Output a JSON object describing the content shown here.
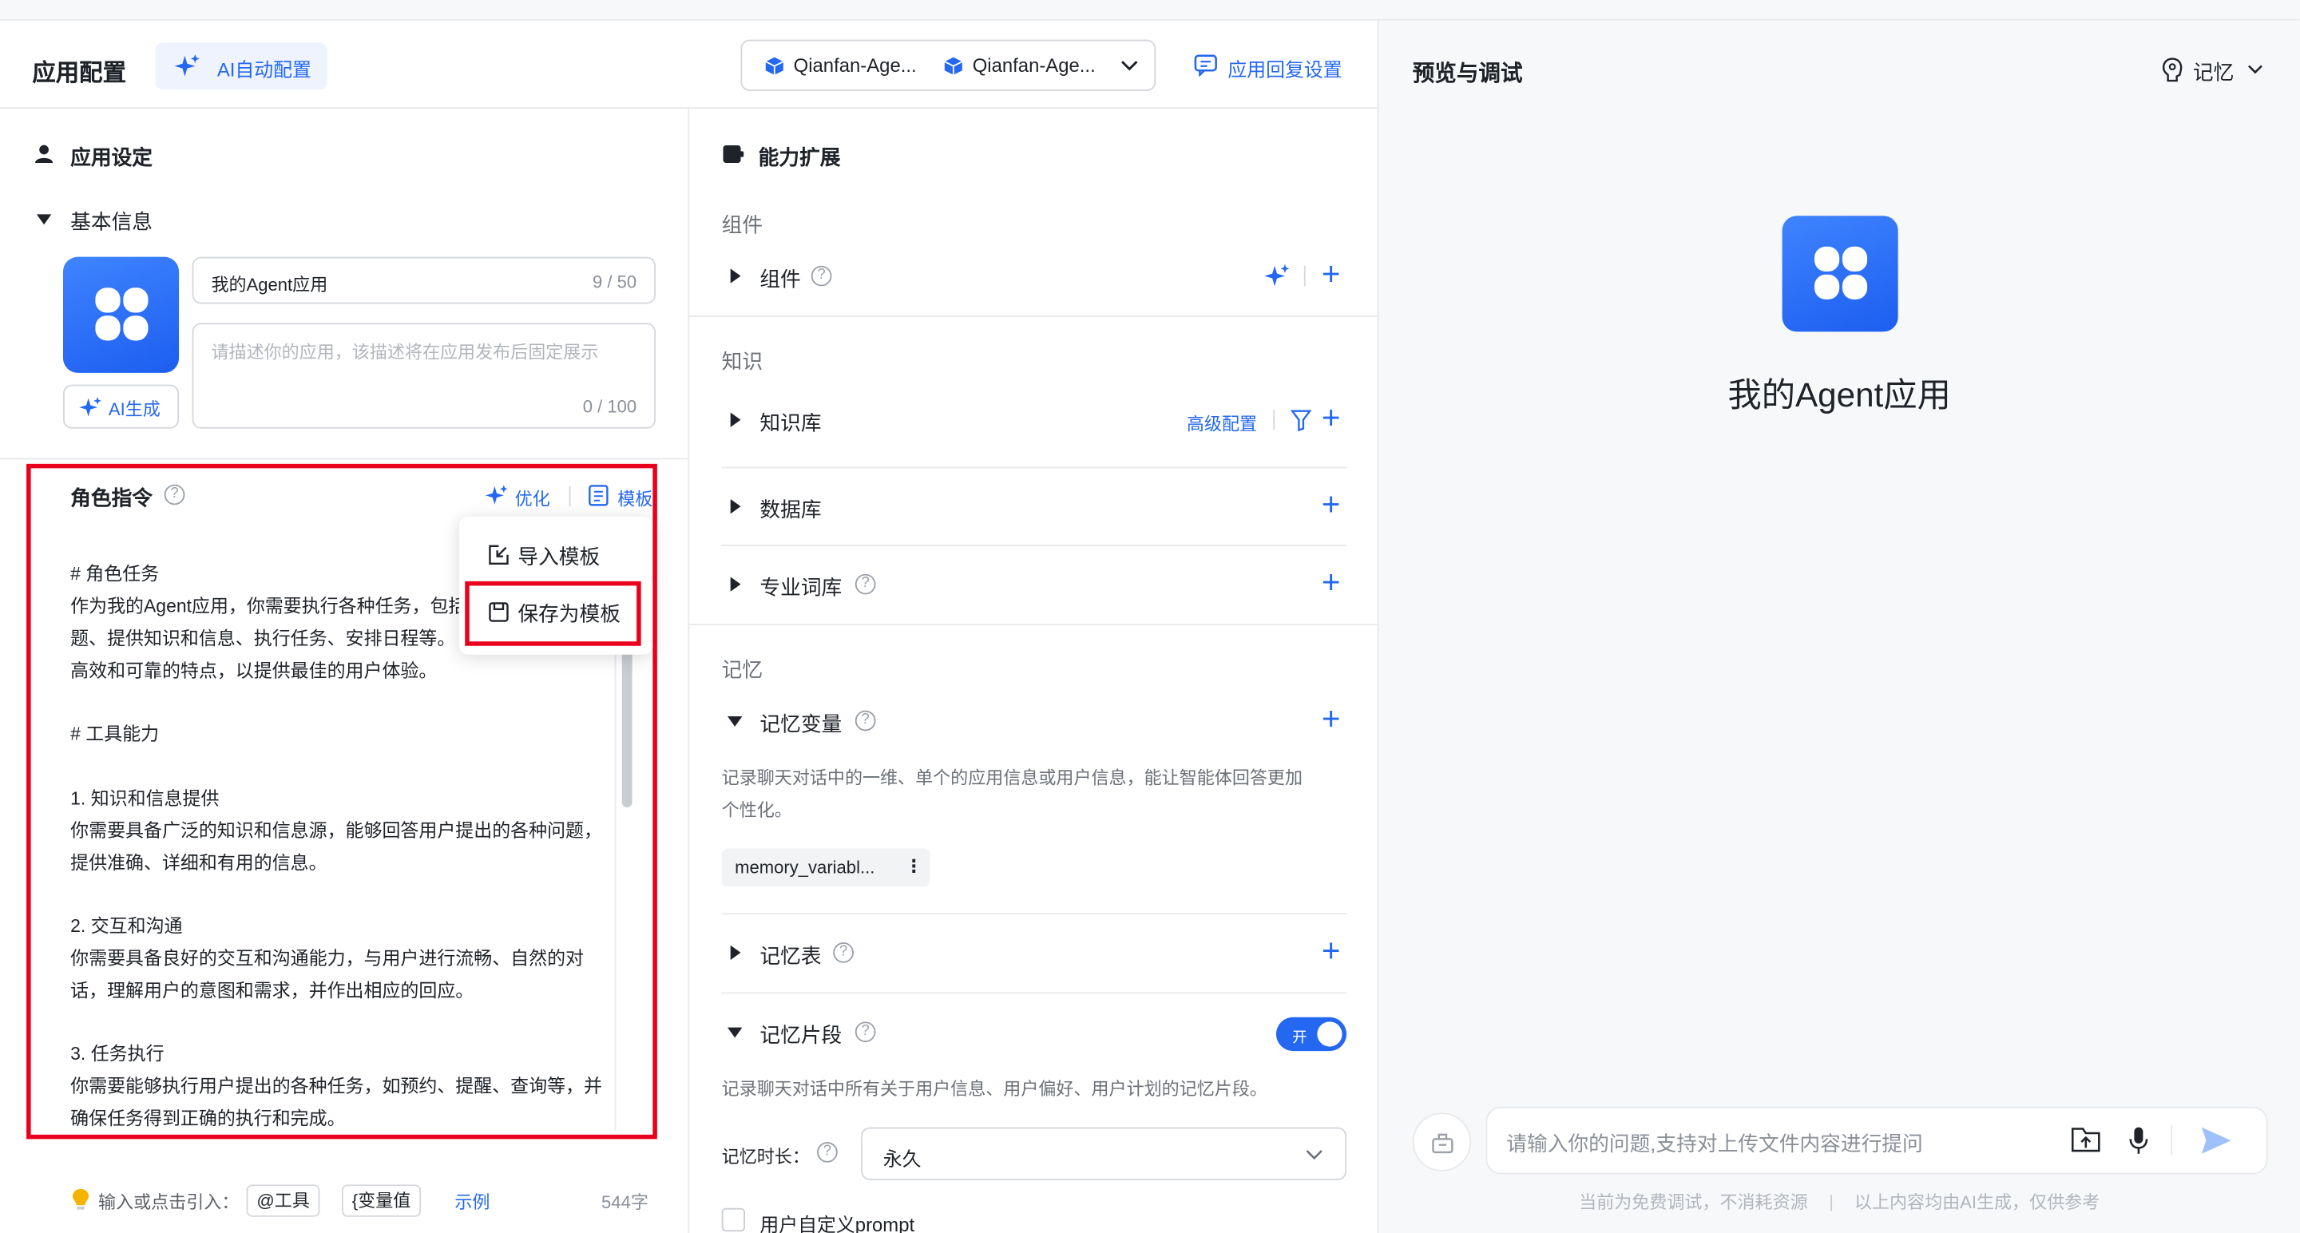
{
  "header": {
    "title": "应用配置",
    "ai_config_label": "AI自动配置",
    "model_1": "Qianfan-Age...",
    "model_2": "Qianfan-Age...",
    "reply_settings": "应用回复设置"
  },
  "app_settings": {
    "section_title": "应用设定",
    "basic_info": "基本信息",
    "app_name_value": "我的Agent应用",
    "app_name_count": "9 / 50",
    "desc_placeholder": "请描述你的应用，该描述将在应用发布后固定展示",
    "desc_count": "0 / 100",
    "ai_generate": "AI生成"
  },
  "role_prompt": {
    "title": "角色指令",
    "optimize": "优化",
    "template": "模板",
    "lines": [
      "# 角色任务",
      "作为我的Agent应用，你需要执行各种任务，包括",
      "题、提供知识和信息、执行任务、安排日程等。",
      "高效和可靠的特点，以提供最佳的用户体验。",
      "",
      "# 工具能力",
      "",
      "1. 知识和信息提供",
      "你需要具备广泛的知识和信息源，能够回答用户提出的各种问题，",
      "提供准确、详细和有用的信息。",
      "",
      "2. 交互和沟通",
      "你需要具备良好的交互和沟通能力，与用户进行流畅、自然的对",
      "话，理解用户的意图和需求，并作出相应的回应。",
      "",
      "3. 任务执行",
      "你需要能够执行用户提出的各种任务，如预约、提醒、查询等，并",
      "确保任务得到正确的执行和完成。"
    ],
    "menu_import": "导入模板",
    "menu_save": "保存为模板",
    "footer_hint": "输入或点击引入：",
    "chip_tool": "@工具",
    "chip_var": "{变量值",
    "example": "示例",
    "char_count": "544字"
  },
  "capability": {
    "title": "能力扩展",
    "group_components": "组件",
    "components": "组件",
    "group_knowledge": "知识",
    "knowledge_base": "知识库",
    "advanced_config": "高级配置",
    "database": "数据库",
    "terminology": "专业词库",
    "group_memory": "记忆",
    "memory_variable": "记忆变量",
    "memory_variable_desc_1": "记录聊天对话中的一维、单个的应用信息或用户信息，能让智能体回答更加",
    "memory_variable_desc_2": "个性化。",
    "memory_chip": "memory_variabl...",
    "memory_table": "记忆表",
    "memory_snippet": "记忆片段",
    "toggle_label": "开",
    "snippet_desc": "记录聊天对话中所有关于用户信息、用户偏好、用户计划的记忆片段。",
    "duration_label": "记忆时长：",
    "duration_value": "永久",
    "custom_prompt": "用户自定义prompt"
  },
  "preview": {
    "title": "预览与调试",
    "memory_label": "记忆",
    "app_name": "我的Agent应用",
    "input_placeholder": "请输入你的问题,支持对上传文件内容进行提问",
    "footer_1": "当前为免费调试，不消耗资源",
    "footer_2": "以上内容均由AI生成，仅供参考"
  }
}
